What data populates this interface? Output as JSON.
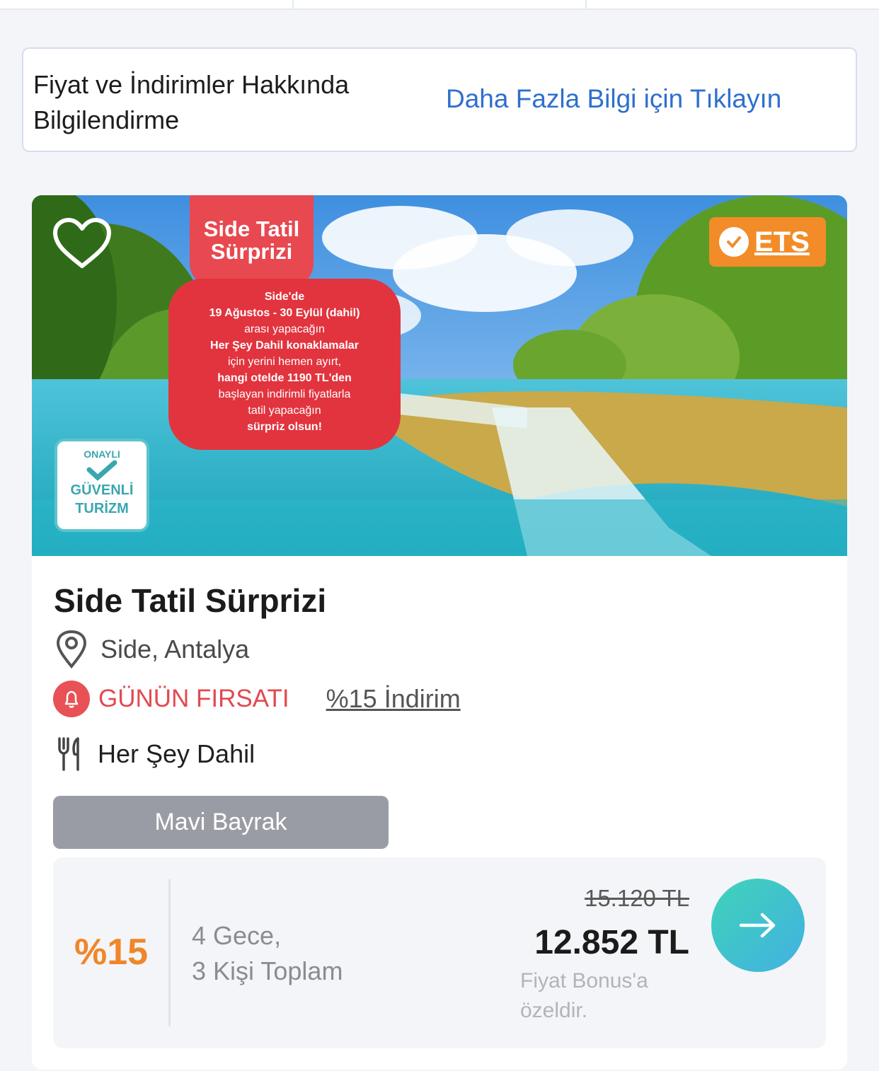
{
  "info": {
    "title": "Fiyat ve İndirimler Hakkında Bilgilendirme",
    "link": "Daha Fazla Bilgi için Tıklayın"
  },
  "card": {
    "promo": {
      "headline": "Side Tatil Sürprizi",
      "lines": [
        "Side'de",
        "19 Ağustos - 30 Eylül (dahil)",
        "arası yapacağın",
        "Her Şey Dahil konaklamalar",
        "için yerini hemen ayırt,",
        "hangi otelde 1190 TL'den",
        "başlayan indirimli fiyatlarla",
        "tatil yapacağın",
        "sürpriz olsun!"
      ]
    },
    "badge_ets": "ETS",
    "safe_badge": {
      "top": "ONAYLI",
      "line1": "GÜVENLİ",
      "line2": "TURİZM"
    },
    "title": "Side Tatil Sürprizi",
    "location": "Side, Antalya",
    "deal_label": "GÜNÜN FIRSATI",
    "discount_link": "%15 İndirim",
    "board_type": "Her Şey Dahil",
    "flag_button": "Mavi Bayrak",
    "price": {
      "discount_pct": "%15",
      "nights_line1": "4 Gece,",
      "nights_line2": "3 Kişi Toplam",
      "old_price": "15.120 TL",
      "new_price": "12.852 TL",
      "bonus_note": "Fiyat Bonus'a özeldir."
    }
  },
  "colors": {
    "link_blue": "#2f6fce",
    "deal_red": "#e24a50",
    "discount_orange": "#f0862a",
    "ets_orange": "#f28c28",
    "flag_grey": "#9a9ca5"
  },
  "icons": [
    "heart-icon",
    "check-icon",
    "location-pin-icon",
    "bell-icon",
    "cutlery-icon",
    "arrow-right-icon"
  ]
}
